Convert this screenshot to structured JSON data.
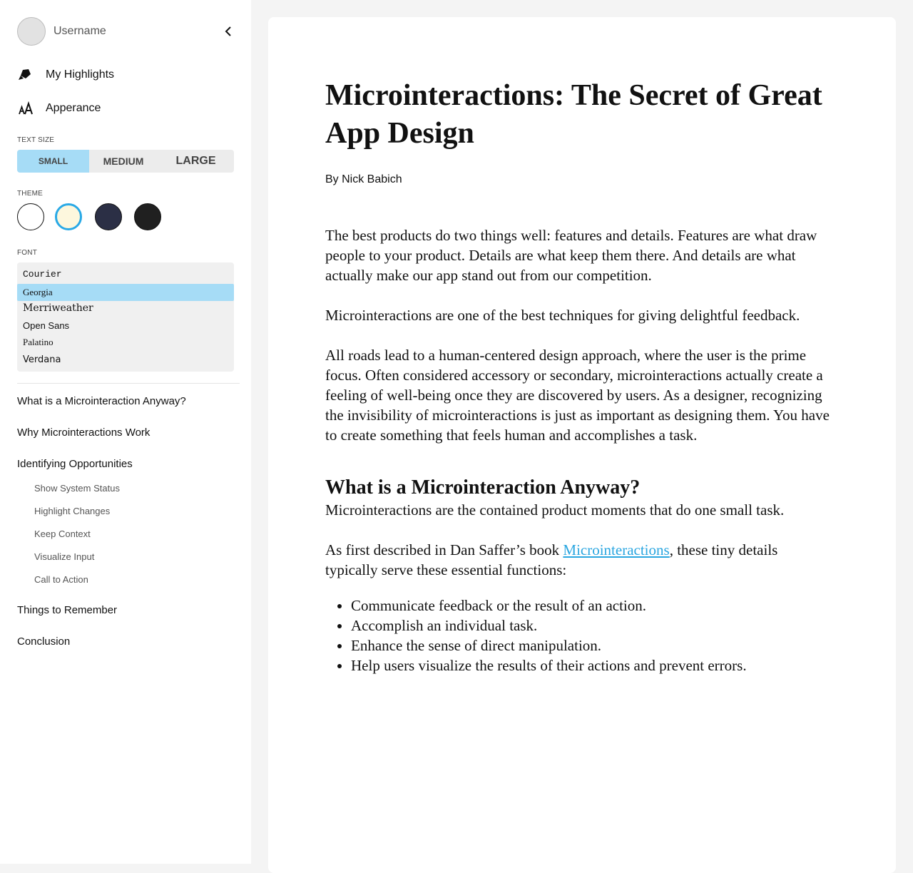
{
  "sidebar": {
    "username": "Username",
    "nav": [
      {
        "label": "My Highlights",
        "icon": "highlighter-icon"
      },
      {
        "label": "Apperance",
        "icon": "text-size-icon"
      }
    ],
    "text_size": {
      "label": "TEXT SIZE",
      "options": [
        "SMALL",
        "MEDIUM",
        "LARGE"
      ],
      "selected": "SMALL"
    },
    "theme": {
      "label": "THEME",
      "options": [
        {
          "name": "white",
          "color": "#ffffff"
        },
        {
          "name": "sepia",
          "color": "#fdf7dd"
        },
        {
          "name": "navy",
          "color": "#2b2f45"
        },
        {
          "name": "black",
          "color": "#202020"
        }
      ],
      "selected": "sepia",
      "selected_ring_color": "#29a9e6"
    },
    "font": {
      "label": "FONT",
      "options": [
        "Courier",
        "Georgia",
        "Merriweather",
        "Open Sans",
        "Palatino",
        "Verdana"
      ],
      "selected": "Georgia"
    },
    "toc": [
      {
        "label": "What is a Microinteraction Anyway?"
      },
      {
        "label": "Why Microinteractions Work"
      },
      {
        "label": "Identifying Opportunities",
        "children": [
          "Show System Status",
          "Highlight Changes",
          "Keep Context",
          "Visualize Input",
          "Call to Action"
        ]
      },
      {
        "label": "Things to Remember"
      },
      {
        "label": "Conclusion"
      }
    ]
  },
  "article": {
    "title": "Microinteractions: The Secret of Great App Design",
    "byline": "By Nick Babich",
    "paragraphs": [
      "The best products do two things well: features and details. Features are what draw people to your product. Details are what keep them there. And details are what actually make our app stand out from our competition.",
      "Microinteractions are one of the best techniques for giving delightful feedback.",
      "All roads lead to a human-centered design approach, where the user is the prime focus. Often considered accessory or secondary, microinteractions actually create a feeling of well-being once they are discovered by users. As a designer, recognizing the invisibility of microinteractions is just as important as designing them. You have to create something that feels human and accomplishes a task."
    ],
    "section_heading": "What is a Microinteraction Anyway?",
    "section_paragraph": "Microinteractions are the contained product moments that do one small task.",
    "saffer_before": "As first described in Dan Saffer’s book ",
    "saffer_link": "Microinteractions",
    "saffer_after": ", these tiny details",
    "saffer_line2": "typically serve these essential functions:",
    "bullets": [
      "Communicate feedback or the result of an action.",
      "Accomplish an individual task.",
      "Enhance the sense of direct manipulation.",
      "Help users visualize the results of their actions and prevent errors."
    ],
    "link_color": "#2aa6e0"
  }
}
